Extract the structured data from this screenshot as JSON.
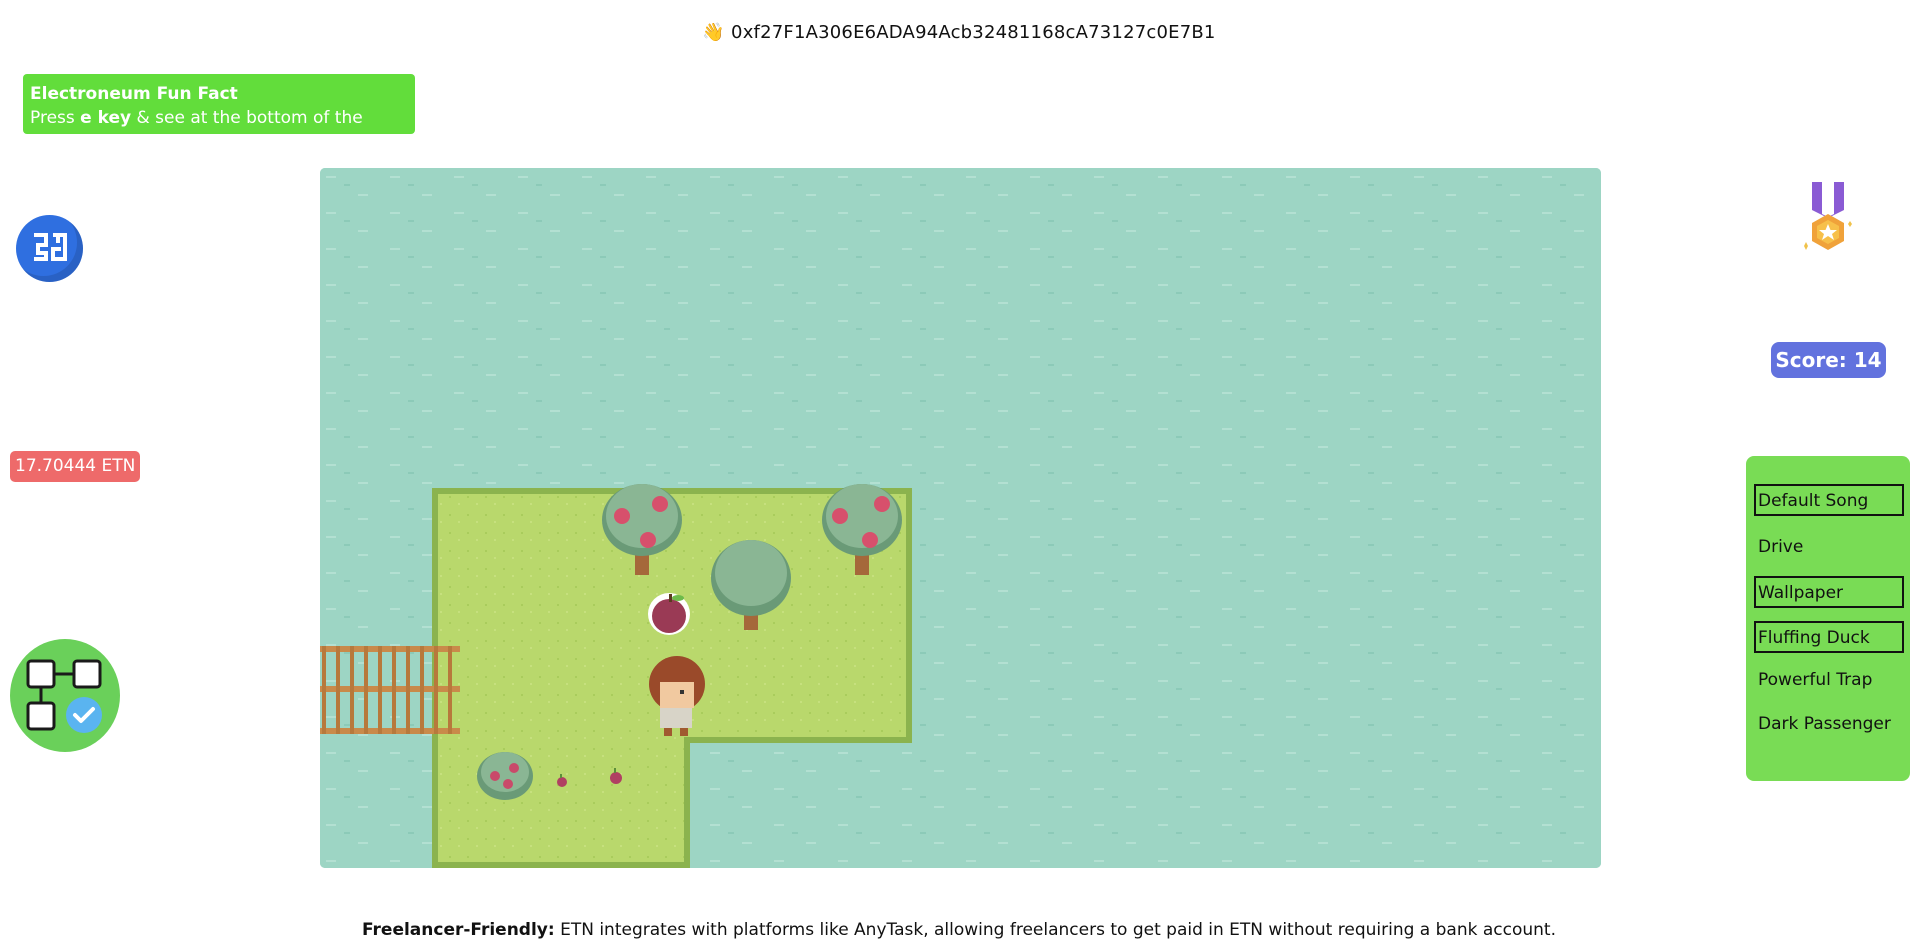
{
  "header": {
    "wave_emoji": "👋",
    "wallet_address": "0xf27F1A306E6ADA94Acb32481168cA73127c0E7B1"
  },
  "fun_fact_box": {
    "title": "Electroneum Fun Fact",
    "line_prefix": "Press ",
    "line_key": "e key",
    "line_suffix": " & see at the bottom of the screen"
  },
  "balance": {
    "label": "17.70444 ETN"
  },
  "score": {
    "label": "Score: 14"
  },
  "playlist": {
    "items": [
      {
        "label": "Default Song",
        "boxed": true
      },
      {
        "label": "Drive",
        "boxed": false
      },
      {
        "label": "Wallpaper",
        "boxed": true
      },
      {
        "label": "Fluffing Duck",
        "boxed": true
      },
      {
        "label": "Powerful Trap",
        "boxed": false
      },
      {
        "label": "Dark Passenger",
        "boxed": false
      }
    ]
  },
  "footer": {
    "fact_label": "Freelancer-Friendly:",
    "fact_text": " ETN integrates with platforms like AnyTask, allowing freelancers to get paid in ETN without requiring a bank account."
  },
  "icons": {
    "left_badge": "qr-code-icon",
    "workflow_badge": "workflow-check-icon",
    "medal": "medal-icon"
  },
  "colors": {
    "water": "#9dd5c4",
    "grass": "#b8d66a",
    "grass_edge": "#8bb34e",
    "fun_fact_bg": "#62dd3b",
    "balance_bg": "#ee6a6a",
    "score_bg": "#6272de",
    "playlist_bg": "#79dc55",
    "badge_blue": "#2f6fe0"
  }
}
